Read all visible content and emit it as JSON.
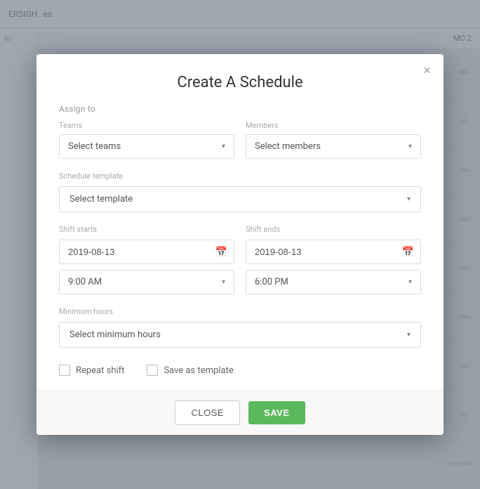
{
  "modal": {
    "title": "Create A Schedule",
    "close_x_label": "×",
    "assign_to_label": "Assign to",
    "teams_label": "Teams",
    "teams_placeholder": "Select teams",
    "members_label": "Members",
    "members_placeholder": "Select members",
    "schedule_template_label": "Schedule template",
    "schedule_template_placeholder": "Select template",
    "shift_starts_label": "Shift starts",
    "shift_starts_date": "2019-08-13",
    "shift_starts_time": "9:00 AM",
    "shift_ends_label": "Shift ends",
    "shift_ends_date": "2019-08-13",
    "shift_ends_time": "6:00 PM",
    "minimum_hours_label": "Minimum hours",
    "minimum_hours_placeholder": "Select minimum hours",
    "repeat_shift_label": "Repeat shift",
    "save_as_template_label": "Save as template",
    "close_button_label": "CLOSE",
    "save_button_label": "SAVE"
  },
  "background": {
    "header_text": "ERSIGH",
    "col_header": "MO 2",
    "time_slots": [
      "AM -",
      "AM -",
      "AM -",
      "AM -",
      "AM -",
      "AM -",
      "AM -",
      "AM -",
      "9:00 AM"
    ]
  }
}
